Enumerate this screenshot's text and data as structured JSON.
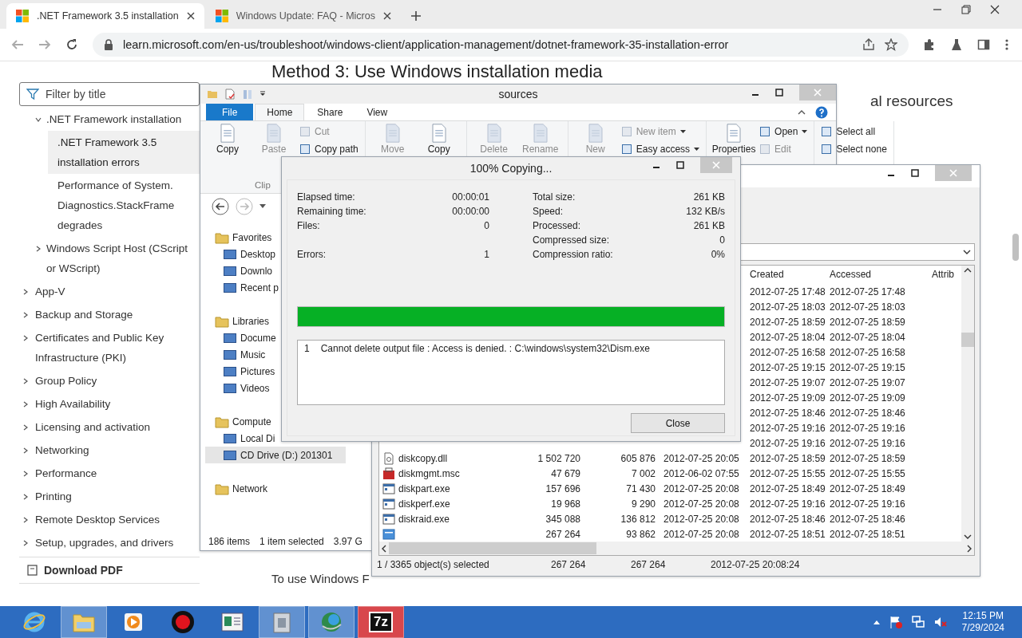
{
  "browser": {
    "tabs": [
      {
        "title": ".NET Framework 3.5 installation",
        "selected": true
      },
      {
        "title": "Windows Update: FAQ - Micros",
        "selected": false
      }
    ],
    "url": "learn.microsoft.com/en-us/troubleshoot/windows-client/application-management/dotnet-framework-35-installation-error"
  },
  "docs": {
    "filter": {
      "placeholder": "Filter by title"
    },
    "toc": [
      {
        "label": ".NET Framework installation",
        "expanded": true,
        "selected": false,
        "children": [
          {
            "label": ".NET Framework 3.5 installation errors",
            "selected": true
          },
          {
            "label": "Performance of System. Diagnostics.StackFrame degrades",
            "selected": false
          }
        ]
      },
      {
        "label": "Windows Script Host (CScript or WScript)",
        "expanded": false,
        "selected": false
      }
    ],
    "sections": [
      {
        "label": "App-V",
        "expanded": false,
        "selected": false
      },
      {
        "label": "Backup and Storage",
        "expanded": false,
        "selected": false
      },
      {
        "label": "Certificates and Public Key Infrastructure (PKI)",
        "expanded": false,
        "selected": false
      },
      {
        "label": "Group Policy",
        "expanded": false,
        "selected": false
      },
      {
        "label": "High Availability",
        "expanded": false,
        "selected": false
      },
      {
        "label": "Licensing and activation",
        "expanded": false,
        "selected": false
      },
      {
        "label": "Networking",
        "expanded": false,
        "selected": false
      },
      {
        "label": "Performance",
        "expanded": false,
        "selected": false
      },
      {
        "label": "Printing",
        "expanded": false,
        "selected": false
      },
      {
        "label": "Remote Desktop Services",
        "expanded": false,
        "selected": false
      },
      {
        "label": "Setup, upgrades, and drivers",
        "expanded": false,
        "selected": false
      }
    ],
    "download": "Download PDF",
    "heading": "Method 3: Use Windows installation media",
    "aside_heading": "al resources",
    "paragraph": "To use Windows F"
  },
  "explorer": {
    "title": "sources",
    "ribbon_tabs": [
      {
        "label": "File",
        "kind": "file",
        "selected": false
      },
      {
        "label": "Home",
        "kind": "tab",
        "selected": true
      },
      {
        "label": "Share",
        "kind": "tab",
        "selected": false
      },
      {
        "label": "View",
        "kind": "tab",
        "selected": false
      }
    ],
    "ribbon": [
      {
        "label": "Clip",
        "items": [
          {
            "kind": "large",
            "label": "Copy",
            "disabled": false
          },
          {
            "kind": "large",
            "label": "Paste",
            "disabled": true
          },
          {
            "kind": "stack",
            "items": [
              {
                "label": "Cut",
                "disabled": true,
                "dropdown": false
              },
              {
                "label": "Copy path",
                "disabled": false,
                "dropdown": false
              }
            ]
          }
        ]
      },
      {
        "items": [
          {
            "kind": "large",
            "label": "Move",
            "disabled": true
          },
          {
            "kind": "large",
            "label": "Copy",
            "disabled": false
          }
        ]
      },
      {
        "items": [
          {
            "kind": "large",
            "label": "Delete",
            "disabled": true
          },
          {
            "kind": "large",
            "label": "Rename",
            "disabled": true
          }
        ]
      },
      {
        "items": [
          {
            "kind": "large",
            "label": "New",
            "disabled": true
          },
          {
            "kind": "stack",
            "items": [
              {
                "label": "New item",
                "disabled": true,
                "dropdown": true
              },
              {
                "label": "Easy access",
                "disabled": false,
                "dropdown": true
              }
            ]
          }
        ]
      },
      {
        "items": [
          {
            "kind": "large",
            "label": "Properties",
            "disabled": false
          },
          {
            "kind": "stack",
            "items": [
              {
                "label": "Open",
                "disabled": false,
                "dropdown": true
              },
              {
                "label": "Edit",
                "disabled": true,
                "dropdown": false
              }
            ]
          }
        ]
      },
      {
        "items": [
          {
            "kind": "stack",
            "items": [
              {
                "label": "Select all",
                "disabled": false,
                "dropdown": false
              },
              {
                "label": "Select none",
                "disabled": false,
                "dropdown": false
              }
            ]
          }
        ]
      }
    ],
    "nav": [
      {
        "label": "Favorites",
        "kind": "header",
        "selected": false
      },
      {
        "label": "Desktop",
        "kind": "item",
        "selected": false
      },
      {
        "label": "Downlo",
        "kind": "item",
        "selected": false
      },
      {
        "label": "Recent p",
        "kind": "item",
        "selected": false
      },
      {
        "label": "Libraries",
        "kind": "header",
        "selected": false
      },
      {
        "label": "Docume",
        "kind": "item",
        "selected": false
      },
      {
        "label": "Music",
        "kind": "item",
        "selected": false
      },
      {
        "label": "Pictures",
        "kind": "item",
        "selected": false
      },
      {
        "label": "Videos",
        "kind": "item",
        "selected": false
      },
      {
        "label": "Compute",
        "kind": "header",
        "selected": false
      },
      {
        "label": "Local Di",
        "kind": "item",
        "selected": false
      },
      {
        "label": "CD Drive (D:) 201301",
        "kind": "item",
        "selected": true
      },
      {
        "label": "Network",
        "kind": "header",
        "selected": false
      }
    ],
    "status": [
      "186 items",
      "1 item selected",
      "3.97 G"
    ]
  },
  "sevenzip": {
    "columns": [
      {
        "label": "Created"
      },
      {
        "label": "Accessed"
      },
      {
        "label": "Attrib"
      }
    ],
    "rows": [
      {
        "created": "2012-07-25 17:48",
        "accessed": "2012-07-25 17:48"
      },
      {
        "created": "2012-07-25 18:03",
        "accessed": "2012-07-25 18:03"
      },
      {
        "created": "2012-07-25 18:59",
        "accessed": "2012-07-25 18:59"
      },
      {
        "created": "2012-07-25 18:04",
        "accessed": "2012-07-25 18:04"
      },
      {
        "created": "2012-07-25 16:58",
        "accessed": "2012-07-25 16:58"
      },
      {
        "created": "2012-07-25 19:15",
        "accessed": "2012-07-25 19:15"
      },
      {
        "created": "2012-07-25 19:07",
        "accessed": "2012-07-25 19:07"
      },
      {
        "created": "2012-07-25 19:09",
        "accessed": "2012-07-25 19:09"
      },
      {
        "created": "2012-07-25 18:46",
        "accessed": "2012-07-25 18:46"
      },
      {
        "created": "2012-07-25 19:16",
        "accessed": "2012-07-25 19:16"
      },
      {
        "created": "2012-07-25 19:16",
        "accessed": "2012-07-25 19:16"
      },
      {
        "kind": "dll",
        "name": "diskcopy.dll",
        "size": "1 502 720",
        "packed": "605 876",
        "modified": "2012-07-25 20:05",
        "created": "2012-07-25 18:59",
        "accessed": "2012-07-25 18:59"
      },
      {
        "kind": "msc",
        "name": "diskmgmt.msc",
        "size": "47 679",
        "packed": "7 002",
        "modified": "2012-06-02 07:55",
        "created": "2012-07-25 15:55",
        "accessed": "2012-07-25 15:55"
      },
      {
        "kind": "exe",
        "name": "diskpart.exe",
        "size": "157 696",
        "packed": "71 430",
        "modified": "2012-07-25 20:08",
        "created": "2012-07-25 18:49",
        "accessed": "2012-07-25 18:49"
      },
      {
        "kind": "exe",
        "name": "diskperf.exe",
        "size": "19 968",
        "packed": "9 290",
        "modified": "2012-07-25 20:08",
        "created": "2012-07-25 19:16",
        "accessed": "2012-07-25 19:16"
      },
      {
        "kind": "exe",
        "name": "diskraid.exe",
        "size": "345 088",
        "packed": "136 812",
        "modified": "2012-07-25 20:08",
        "created": "2012-07-25 18:46",
        "accessed": "2012-07-25 18:46"
      },
      {
        "kind": "blank",
        "size": "267 264",
        "packed": "93 862",
        "modified": "2012-07-25 20:08",
        "created": "2012-07-25 18:51",
        "accessed": "2012-07-25 18:51"
      }
    ],
    "status": [
      "1 / 3365 object(s) selected",
      "267 264",
      "267 264",
      "2012-07-25 20:08:24"
    ]
  },
  "copy_dialog": {
    "title": "100% Copying...",
    "stats": [
      {
        "left": {
          "label": "Elapsed time:",
          "value": "00:00:01"
        },
        "right": {
          "label": "Total size:",
          "value": "261 KB"
        }
      },
      {
        "left": {
          "label": "Remaining time:",
          "value": "00:00:00"
        },
        "right": {
          "label": "Speed:",
          "value": "132 KB/s"
        }
      },
      {
        "left": {
          "label": "Files:",
          "value": "0"
        },
        "right": {
          "label": "Processed:",
          "value": "261 KB"
        }
      },
      {
        "right": {
          "label": "Compressed size:",
          "value": "0"
        }
      },
      {
        "left": {
          "label": "Errors:",
          "value": "1"
        },
        "right": {
          "label": "Compression ratio:",
          "value": "0%"
        }
      }
    ],
    "level": 1.0,
    "errors": [
      {
        "number": "1",
        "message": "Cannot delete output file : Access is denied. : C:\\windows\\system32\\Dism.exe"
      }
    ],
    "button": "Close"
  },
  "taskbar": {
    "apps": [
      {
        "kind": "ring",
        "open": false,
        "active": false
      },
      {
        "kind": "folder",
        "open": true,
        "active": false
      },
      {
        "kind": "play",
        "open": false,
        "active": false
      },
      {
        "kind": "record",
        "open": false,
        "active": false
      },
      {
        "kind": "window",
        "open": false,
        "active": false
      },
      {
        "kind": "box",
        "open": true,
        "active": false
      },
      {
        "kind": "globe",
        "open": true,
        "active": false
      },
      {
        "kind": "label",
        "label": "7z",
        "open": true,
        "active": true
      }
    ],
    "time": "12:15 PM",
    "date": "7/29/2024"
  }
}
